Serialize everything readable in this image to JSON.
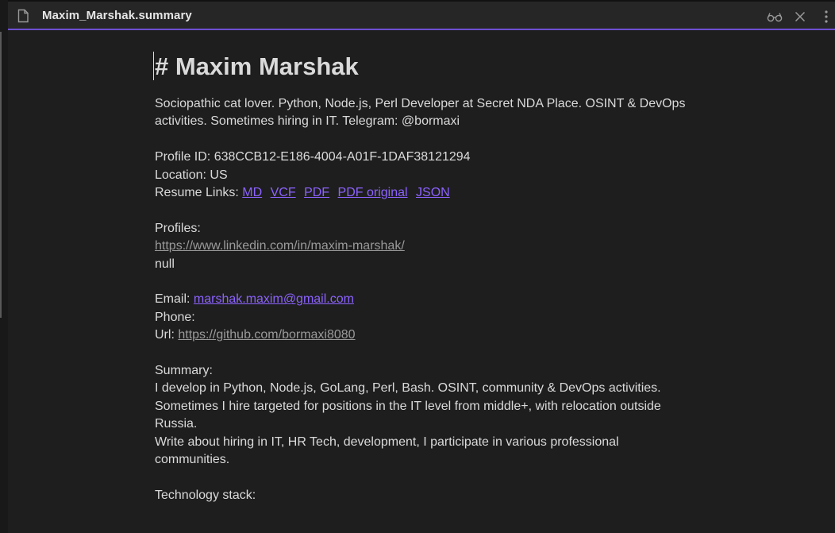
{
  "tab": {
    "title": "Maxim_Marshak.summary",
    "icons": [
      "file-icon",
      "reading-glasses-icon",
      "close-icon",
      "more-options-icon"
    ]
  },
  "doc": {
    "heading": "# Maxim Marshak",
    "intro": "Sociopathic cat lover. Python, Node.js, Perl Developer at Secret NDA Place. OSINT & DevOps activities. Sometimes hiring in IT. Telegram: @bormaxi",
    "profile_id": "Profile ID: 638CCB12-E186-4004-A01F-1DAF38121294",
    "location": "Location: US",
    "resume_links_label": "Resume Links:",
    "resume_links": [
      "MD",
      "VCF",
      "PDF",
      "PDF original",
      "JSON"
    ],
    "profiles_label": "Profiles:",
    "linkedin": "https://www.linkedin.com/in/maxim-marshak/",
    "null_text": "null",
    "email_label": "Email:",
    "email": "marshak.maxim@gmail.com",
    "phone_label": "Phone:",
    "url_label": "Url:",
    "url": "https://github.com/bormaxi8080",
    "summary_label": "Summary:",
    "summary_line1": "I develop in Python, Node.js, GoLang, Perl, Bash. OSINT, community & DevOps activities.",
    "summary_line2": "Sometimes I hire targeted for positions in the IT level from middle+, with relocation outside Russia.",
    "summary_line3": "Write about hiring in IT, HR Tech, development, I participate in various professional communities.",
    "tech_label": "Technology stack:"
  },
  "colors": {
    "background": "#1e1e1e",
    "text": "#dadada",
    "accent_link": "#8c63ff",
    "external_link": "#9a9a9a",
    "tab_underline": "#6d4fd2"
  }
}
